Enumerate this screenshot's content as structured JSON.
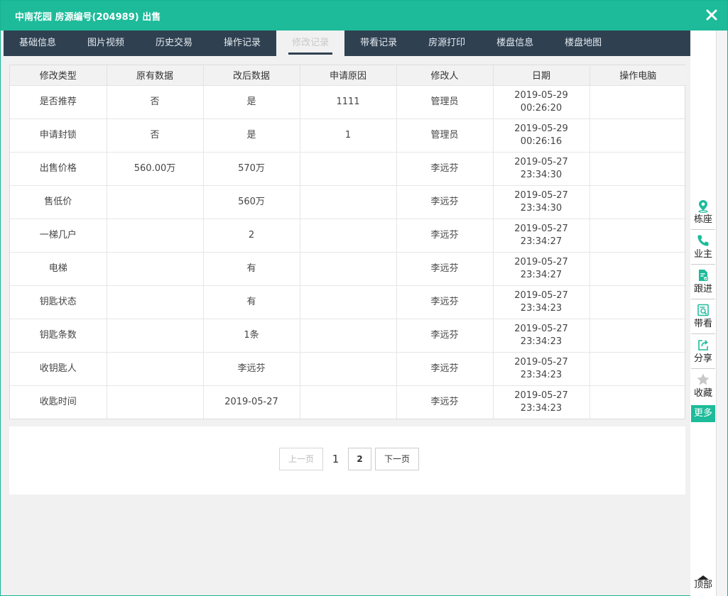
{
  "window": {
    "title": "中南花园 房源编号(204989) 出售"
  },
  "tabs": [
    {
      "label": "基础信息"
    },
    {
      "label": "图片视频"
    },
    {
      "label": "历史交易"
    },
    {
      "label": "操作记录"
    },
    {
      "label": "修改记录"
    },
    {
      "label": "带看记录"
    },
    {
      "label": "房源打印"
    },
    {
      "label": "楼盘信息"
    },
    {
      "label": "楼盘地图"
    }
  ],
  "active_tab": "修改记录",
  "table": {
    "headers": [
      "修改类型",
      "原有数据",
      "改后数据",
      "申请原因",
      "修改人",
      "日期",
      "操作电脑"
    ],
    "rows": [
      {
        "type": "是否推荐",
        "old": "否",
        "new": "是",
        "reason": "1111",
        "editor": "管理员",
        "date": "2019-05-29",
        "time": "00:26:20",
        "pc": ""
      },
      {
        "type": "申请封锁",
        "old": "否",
        "new": "是",
        "reason": "1",
        "editor": "管理员",
        "date": "2019-05-29",
        "time": "00:26:16",
        "pc": ""
      },
      {
        "type": "出售价格",
        "old": "560.00万",
        "new": "570万",
        "reason": "",
        "editor": "李远芬",
        "date": "2019-05-27",
        "time": "23:34:30",
        "pc": ""
      },
      {
        "type": "售低价",
        "old": "",
        "new": "560万",
        "reason": "",
        "editor": "李远芬",
        "date": "2019-05-27",
        "time": "23:34:30",
        "pc": ""
      },
      {
        "type": "一梯几户",
        "old": "",
        "new": "2",
        "reason": "",
        "editor": "李远芬",
        "date": "2019-05-27",
        "time": "23:34:27",
        "pc": ""
      },
      {
        "type": "电梯",
        "old": "",
        "new": "有",
        "reason": "",
        "editor": "李远芬",
        "date": "2019-05-27",
        "time": "23:34:27",
        "pc": ""
      },
      {
        "type": "钥匙状态",
        "old": "",
        "new": "有",
        "reason": "",
        "editor": "李远芬",
        "date": "2019-05-27",
        "time": "23:34:23",
        "pc": ""
      },
      {
        "type": "钥匙条数",
        "old": "",
        "new": "1条",
        "reason": "",
        "editor": "李远芬",
        "date": "2019-05-27",
        "time": "23:34:23",
        "pc": ""
      },
      {
        "type": "收钥匙人",
        "old": "",
        "new": "李远芬",
        "reason": "",
        "editor": "李远芬",
        "date": "2019-05-27",
        "time": "23:34:23",
        "pc": ""
      },
      {
        "type": "收匙时间",
        "old": "",
        "new": "2019-05-27",
        "reason": "",
        "editor": "李远芬",
        "date": "2019-05-27",
        "time": "23:34:23",
        "pc": ""
      }
    ]
  },
  "pager": {
    "prev_label": "上一页",
    "current_page": "1",
    "next_page_number": "2",
    "next_label": "下一页"
  },
  "right_toolbar": {
    "items": [
      {
        "label": "栋座",
        "icon": "location-pin-icon"
      },
      {
        "label": "业主",
        "icon": "phone-icon"
      },
      {
        "label": "跟进",
        "icon": "document-edit-icon"
      },
      {
        "label": "带看",
        "icon": "search-document-icon"
      },
      {
        "label": "分享",
        "icon": "share-icon"
      },
      {
        "label": "收藏",
        "icon": "star-icon"
      }
    ],
    "more_label": "更多",
    "top_label": "顶部"
  },
  "colors": {
    "accent": "#1dbb9a",
    "tab_bar": "#2f4051",
    "star": "#c8c8c8"
  }
}
